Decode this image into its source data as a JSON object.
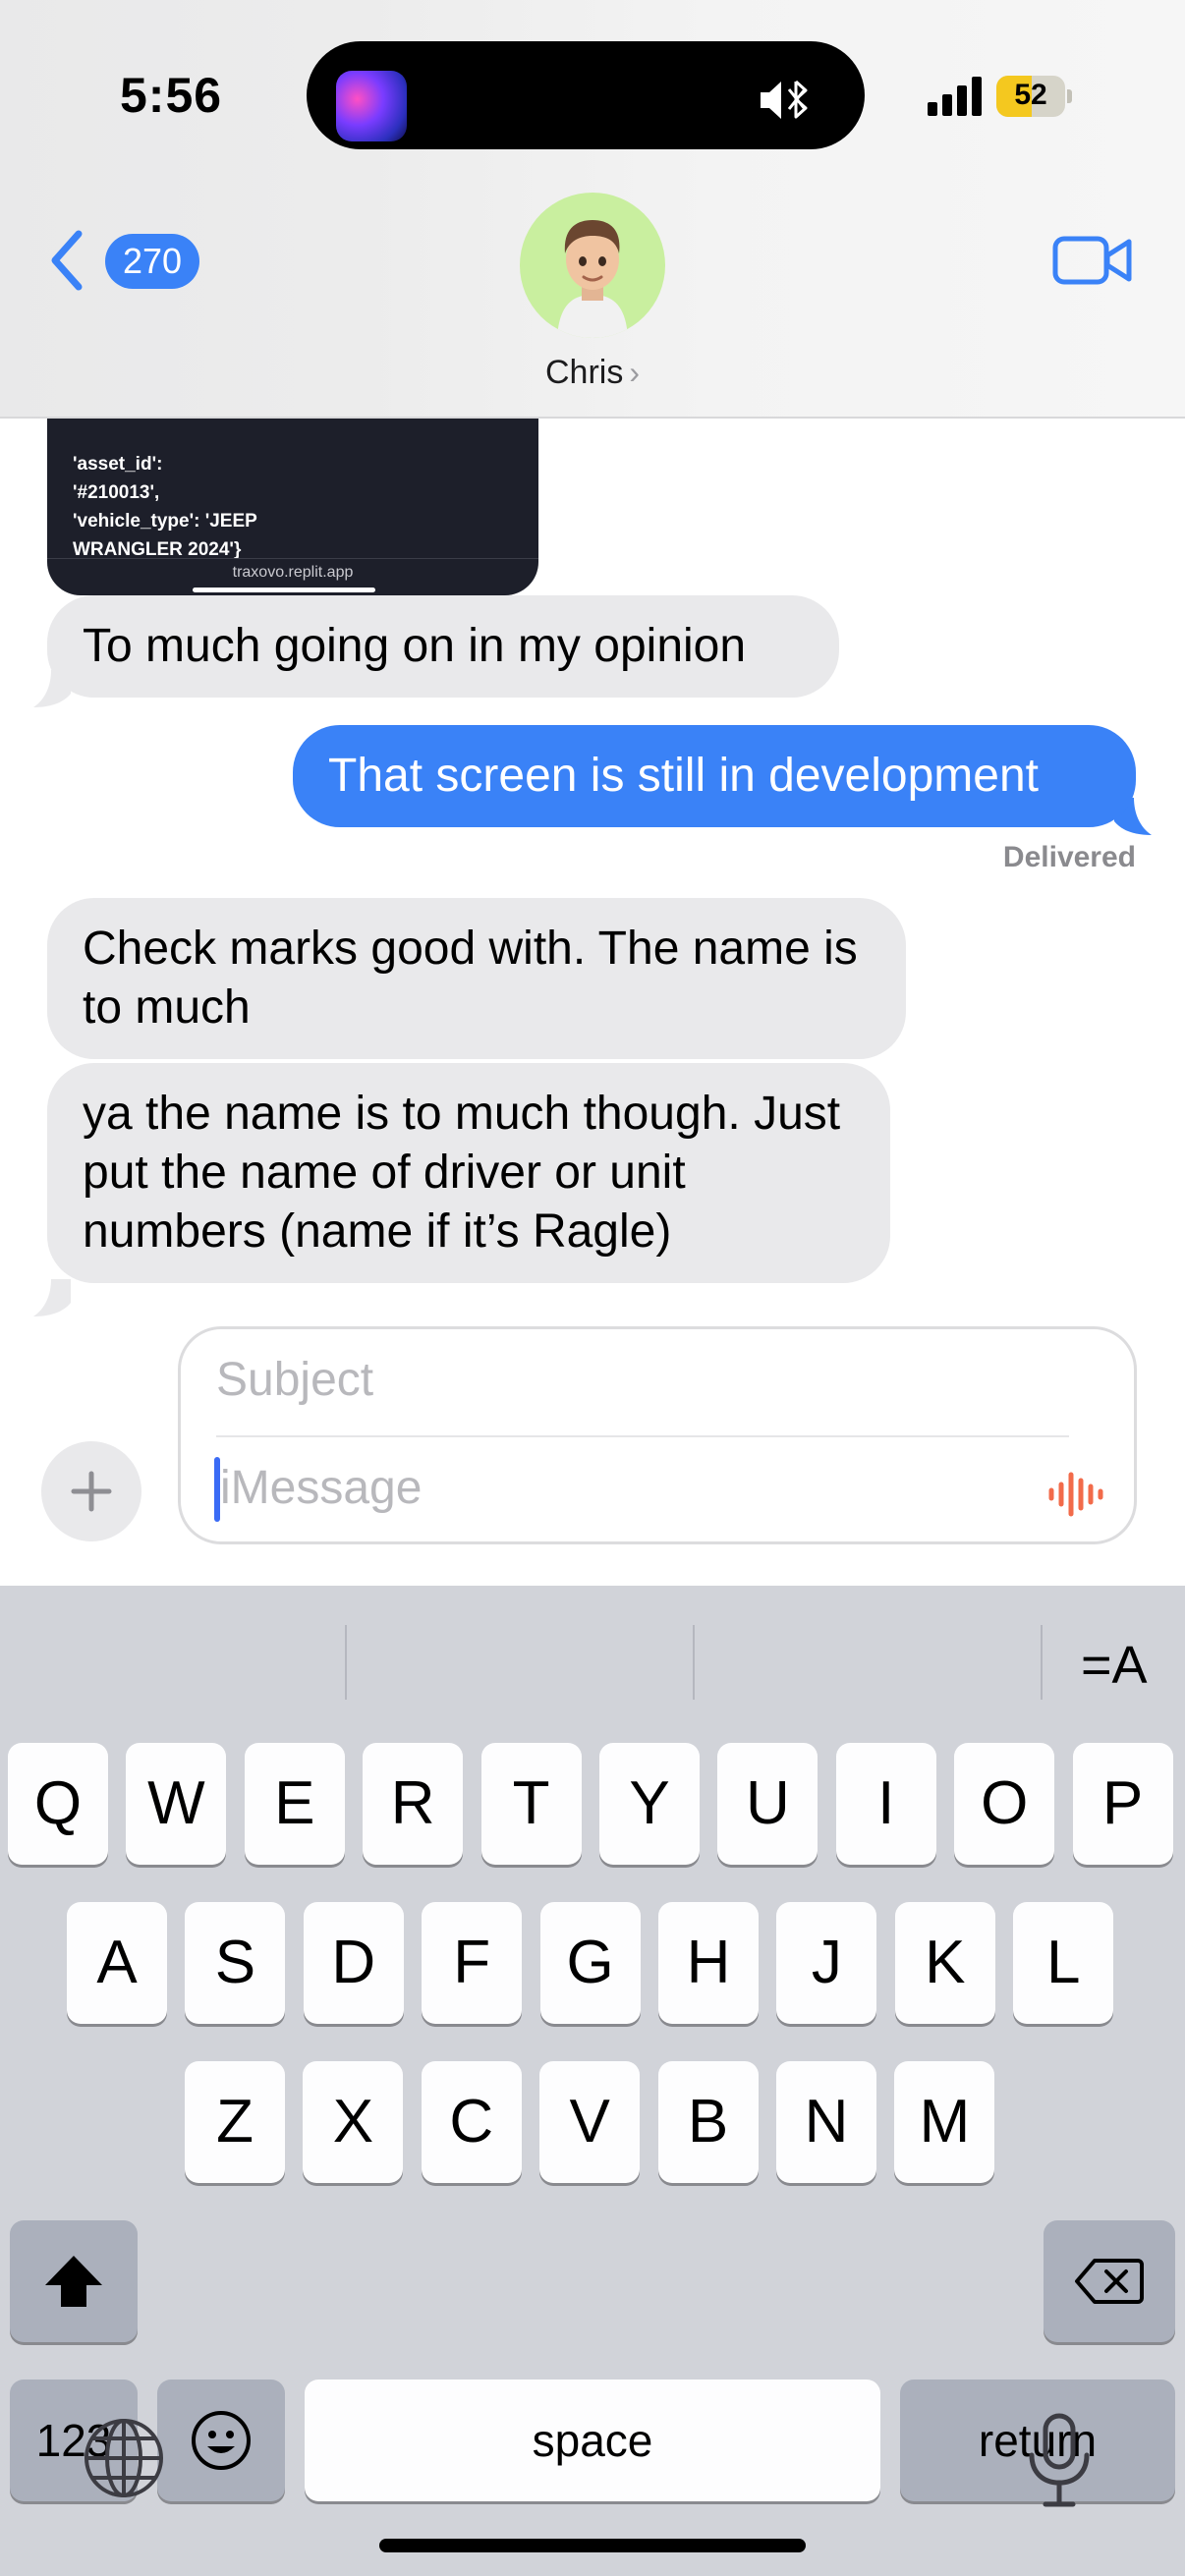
{
  "status_bar": {
    "time": "5:56",
    "battery_percent": "52",
    "battery_level": 0.52,
    "accent_battery": "#f4c81f"
  },
  "header": {
    "back_count": "270",
    "contact_name": "Chris",
    "contact_chevron": "›",
    "accent": "#3a82f7"
  },
  "link_preview": {
    "text": "'asset_id':\n'#210013',\n'vehicle_type': 'JEEP\nWRANGLER 2024'}",
    "url": "traxovo.replit.app"
  },
  "messages": [
    {
      "direction": "in",
      "text": "To much going on in my opinion"
    },
    {
      "direction": "out",
      "text": "That screen is still in development"
    },
    {
      "direction": "in",
      "text": "Check marks good with. The name is to much"
    },
    {
      "direction": "in",
      "text": "ya the name is to much though. Just put the name of driver or unit numbers (name if it’s Ragle)"
    }
  ],
  "delivered_label": "Delivered",
  "compose": {
    "subject_placeholder": "Subject",
    "message_placeholder": "iMessage"
  },
  "keyboard": {
    "row1": [
      "Q",
      "W",
      "E",
      "R",
      "T",
      "Y",
      "U",
      "I",
      "O",
      "P"
    ],
    "row2": [
      "A",
      "S",
      "D",
      "F",
      "G",
      "H",
      "J",
      "K",
      "L"
    ],
    "row3": [
      "Z",
      "X",
      "C",
      "V",
      "B",
      "N",
      "M"
    ],
    "numbers_label": "123",
    "space_label": "space",
    "return_label": "return",
    "format_label": "=A"
  }
}
